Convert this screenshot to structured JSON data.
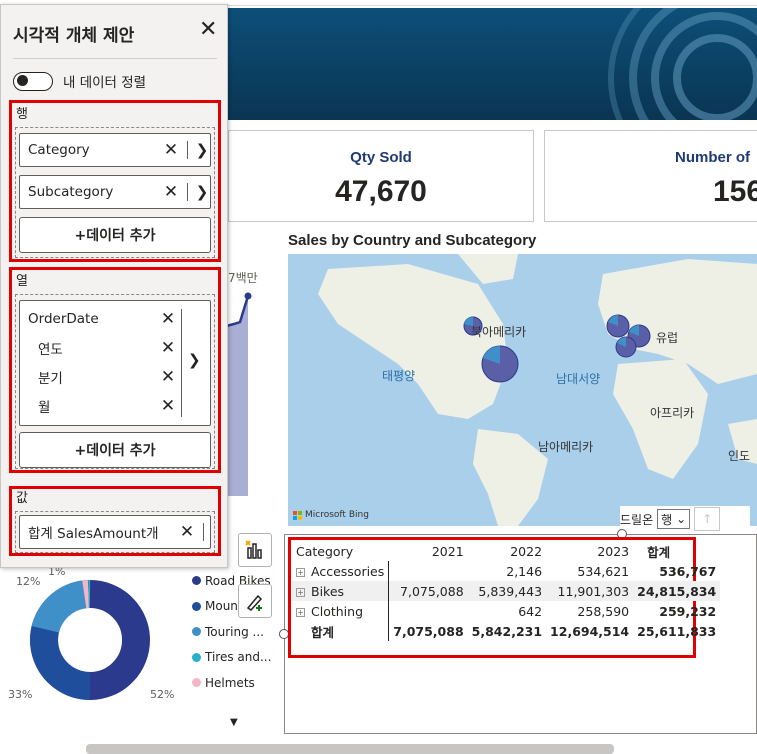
{
  "panel": {
    "title": "시각적 개체 제안",
    "toggle_label": "내 데이터 정렬",
    "rows": {
      "label": "행",
      "fields": [
        "Category",
        "Subcategory"
      ],
      "add_label": "+데이터 추가"
    },
    "columns": {
      "label": "열",
      "group": "OrderDate",
      "levels": [
        "연도",
        "분기",
        "월"
      ],
      "add_label": "+데이터 추가"
    },
    "values": {
      "label": "값",
      "field": "합계 SalesAmount개"
    }
  },
  "cards": [
    {
      "title": "Qty Sold",
      "value": "47,670"
    },
    {
      "title": "Number of",
      "value": "156"
    }
  ],
  "line_chart": {
    "label": "7백만"
  },
  "map": {
    "title": "Sales by Country and Subcategory",
    "labels": {
      "north_america": "북아메리카",
      "europe": "유럽",
      "pacific": "태평양",
      "atlantic": "남대서양",
      "africa": "아프리카",
      "south_america": "남아메리카",
      "india": "인도"
    },
    "attribution": "Microsoft Bing"
  },
  "drill": {
    "label": "드릴온",
    "selected": "행"
  },
  "matrix": {
    "headers": [
      "Category",
      "2021",
      "2022",
      "2023",
      "합계"
    ],
    "rows": [
      {
        "category": "Accessories",
        "y2021": "",
        "y2022": "2,146",
        "y2023": "534,621",
        "total": "536,767"
      },
      {
        "category": "Bikes",
        "y2021": "7,075,088",
        "y2022": "5,839,443",
        "y2023": "11,901,303",
        "total": "24,815,834"
      },
      {
        "category": "Clothing",
        "y2021": "",
        "y2022": "642",
        "y2023": "258,590",
        "total": "259,232"
      }
    ],
    "total": {
      "label": "합계",
      "y2021": "7,075,088",
      "y2022": "5,842,231",
      "y2023": "12,694,514",
      "total": "25,611,833"
    }
  },
  "donut": {
    "pct_top": "1%",
    "pct_left": "12%",
    "pct_bottom_left": "33%",
    "pct_bottom_right": "52%",
    "legend": [
      {
        "label": "Road Bikes",
        "color": "#2b3a8c"
      },
      {
        "label": "Moun...",
        "color": "#1f4e9c"
      },
      {
        "label": "Touring ...",
        "color": "#3f8fc9"
      },
      {
        "label": "Tires and...",
        "color": "#2ab0c9"
      },
      {
        "label": "Helmets",
        "color": "#f3b6c6"
      }
    ]
  },
  "colors": {
    "highlight": "#e00000",
    "banner": "#0b3f61",
    "card_title": "#1f3b73"
  }
}
